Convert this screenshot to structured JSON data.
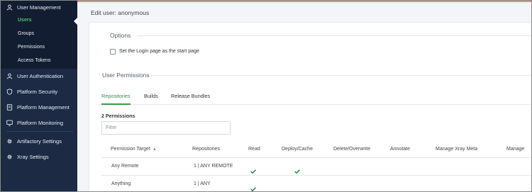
{
  "sidebar": {
    "user_management": "User Management",
    "sub_items": [
      "Users",
      "Groups",
      "Permissions",
      "Access Tokens"
    ],
    "items": [
      {
        "label": "User Authentication",
        "icon": "user-icon"
      },
      {
        "label": "Platform Security",
        "icon": "shield-icon"
      },
      {
        "label": "Platform Management",
        "icon": "document-icon"
      },
      {
        "label": "Platform Monitoring",
        "icon": "monitor-icon"
      },
      {
        "label": "Artifactory Settings",
        "icon": "gear-icon"
      },
      {
        "label": "Xray Settings",
        "icon": "gear-icon"
      }
    ],
    "active_color": "#54c26b"
  },
  "main": {
    "title": "Edit user: anonymous",
    "options_title": "Options",
    "login_checkbox_label": "Set the Login page as the start page",
    "login_checkbox_checked": false,
    "permissions_title": "User Permissions",
    "tabs": [
      "Repositories",
      "Builds",
      "Release Bundles"
    ],
    "active_tab": "Repositories",
    "permissions_count": "2 Permissions",
    "filter_placeholder": "Filter",
    "table": {
      "headers": [
        "Permission Target",
        "Repositories",
        "Read",
        "Deploy/Cache",
        "Delete/Overwrite",
        "Annotate",
        "Manage Xray Meta",
        "Manage"
      ],
      "sort_indicator": "▲",
      "rows": [
        {
          "target": "Any Remote",
          "repositories": "1 | ANY REMOTE",
          "read": true,
          "deploy_cache": true
        },
        {
          "target": "Anything",
          "repositories": "1 | ANY",
          "read": true,
          "deploy_cache": false
        }
      ]
    },
    "accent_color": "#3a9a4c"
  }
}
